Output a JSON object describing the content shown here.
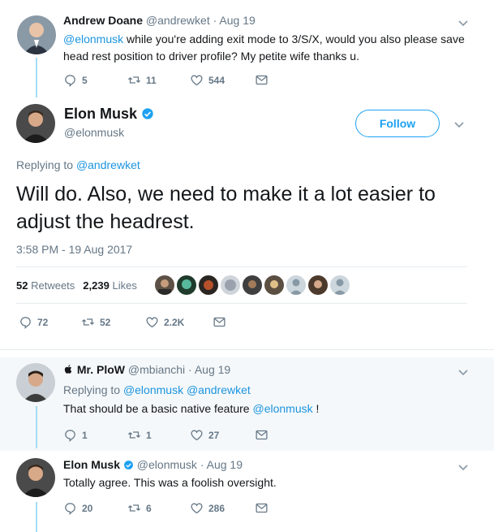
{
  "tweet1": {
    "name": "Andrew Doane",
    "handle": "@andrewket",
    "sep": "·",
    "date": "Aug 19",
    "mention": "@elonmusk",
    "text_line1": " while you're adding exit mode to 3/S/X, would you also please save",
    "text_line2": "head rest position to driver profile? My petite wife thanks u.",
    "replies": "5",
    "retweets": "11",
    "likes": "544"
  },
  "main": {
    "name": "Elon Musk",
    "handle": "@elonmusk",
    "follow_label": "Follow",
    "replying_prefix": "Replying to",
    "replying_to": "@andrewket",
    "text": "Will do. Also, we need to make it a lot easier to adjust the headrest.",
    "timestamp": "3:58 PM - 19 Aug 2017",
    "retweets_count": "52",
    "retweets_label": "Retweets",
    "likes_count": "2,239",
    "likes_label": "Likes",
    "replies": "72",
    "retweets": "52",
    "likes": "2.2K"
  },
  "reply1": {
    "name": "Mr. PloW",
    "handle": "@mbianchi",
    "sep": "·",
    "date": "Aug 19",
    "replying_prefix": "Replying to",
    "replying_to_1": "@elonmusk",
    "replying_to_2": "@andrewket",
    "text": "That should be a basic native feature ",
    "text_mention": "@elonmusk",
    "text_suffix": " !",
    "replies": "1",
    "retweets": "1",
    "likes": "27"
  },
  "reply2": {
    "name": "Elon Musk",
    "handle": "@elonmusk",
    "sep": "·",
    "date": "Aug 19",
    "text": "Totally agree. This was a foolish oversight.",
    "replies": "20",
    "retweets": "6",
    "likes": "286"
  },
  "icons": {
    "reply": "reply-icon",
    "retweet": "retweet-icon",
    "like": "heart-icon",
    "dm": "envelope-icon",
    "more": "chevron-down-icon",
    "verified": "verified-badge-icon",
    "apple": "apple-logo-icon"
  },
  "colors": {
    "link": "#1b95e0",
    "follow": "#1da1f2",
    "muted": "#657786",
    "thread_line": "#a5dcf5",
    "reply_background": "#f5f8fa"
  }
}
